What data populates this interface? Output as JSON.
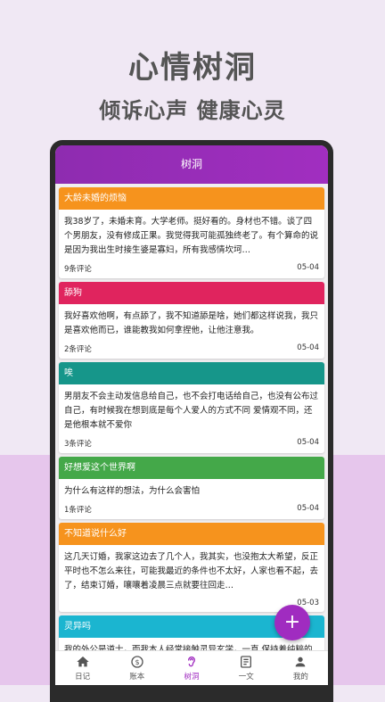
{
  "promo": {
    "title": "心情树洞",
    "subtitle": "倾诉心声 健康心灵"
  },
  "appbar": {
    "title": "树洞"
  },
  "colors": {
    "accent": "#a02cc0"
  },
  "posts": [
    {
      "title": "大龄未婚的烦恼",
      "color": "#f6931d",
      "body": "我38岁了，未婚未育。大学老师。挺好看的。身材也不错。谈了四个男朋友，没有修成正果。我觉得我可能孤独终老了。有个算命的说是因为我出生时接生婆是寡妇，所有我感情坎坷…",
      "comments": "9条评论",
      "date": "05-04"
    },
    {
      "title": "舔狗",
      "color": "#e0245e",
      "body": "我好喜欢他啊，有点舔了，我不知道舔是啥，她们都这样说我，我只是喜欢他而已，谁能教我如何拿捏他，让他注意我。",
      "comments": "2条评论",
      "date": "05-04"
    },
    {
      "title": "唉",
      "color": "#16968a",
      "body": "男朋友不会主动发信息给自己，也不会打电话给自己，也没有公布过自己，有时候我在想到底是每个人爱人的方式不同  爱情观不同，还是他根本就不爱你",
      "comments": "3条评论",
      "date": "05-04"
    },
    {
      "title": "好想爱这个世界啊",
      "color": "#44a849",
      "body": "为什么有这样的想法，为什么会害怕",
      "comments": "1条评论",
      "date": "05-04"
    },
    {
      "title": "不知道说什么好",
      "color": "#f6931d",
      "body": "这几天订婚，我家这边去了几个人，我其实，也没抱太大希望，反正平时也不怎么来往，可能我最近的条件也不太好，人家也看不起，去了，结束订婚，嚷嚷着凌晨三点就要往回走…",
      "comments": "",
      "date": "05-03"
    },
    {
      "title": "灵异吗",
      "color": "#1bb5d0",
      "body": "我的外公是道士，而我本人经常接触灵异玄学，一直 保持着纯粹的好奇，某天你生会做各种奇怪的梦，某天预知梦",
      "comments": "",
      "date": ""
    }
  ],
  "nav": [
    {
      "label": "日记",
      "icon": "home-icon",
      "active": false
    },
    {
      "label": "账本",
      "icon": "dollar-icon",
      "active": false
    },
    {
      "label": "树洞",
      "icon": "ear-icon",
      "active": true
    },
    {
      "label": "一文",
      "icon": "article-icon",
      "active": false
    },
    {
      "label": "我的",
      "icon": "person-icon",
      "active": false
    }
  ],
  "fab": {
    "label": "+"
  }
}
